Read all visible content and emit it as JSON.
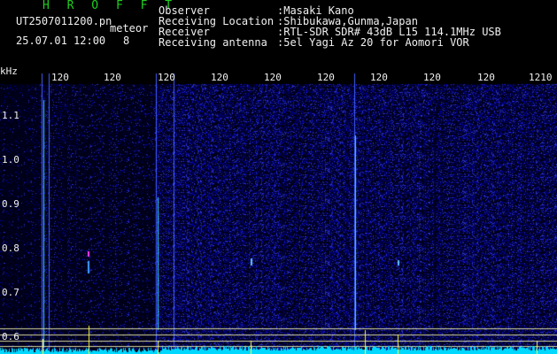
{
  "header": {
    "title": "H R O F F T",
    "filename": "UT2507011200.pn",
    "meteor_label": "meteor",
    "datetime": "25.07.01 12:00",
    "count": "8",
    "observer_info": [
      {
        "label": "Observer",
        "value": ":Masaki Kano"
      },
      {
        "label": "Receiving Location",
        "value": ":Shibukawa,Gunma,Japan"
      },
      {
        "label": "Receiver",
        "value": ":RTL-SDR SDR# 43dB L15 114.1MHz USB"
      },
      {
        "label": "Receiving antenna",
        "value": ":5el Yagi Az 20 for Aomori VOR"
      }
    ]
  },
  "plot": {
    "y_unit": "kHz",
    "y_ticks": [
      "1.1",
      "1.0",
      "0.9",
      "0.8",
      "0.7",
      "0.6"
    ],
    "x_ticks": [
      "120",
      "120",
      "120",
      "120",
      "120",
      "120",
      "120",
      "120",
      "120",
      "1210"
    ],
    "colors": {
      "background": "#000000",
      "noise_low": "#00003a",
      "noise_high": "#3040d0",
      "signal": "#00ffff",
      "marker": "#ffff00",
      "grid": "#d8d8a0"
    }
  }
}
